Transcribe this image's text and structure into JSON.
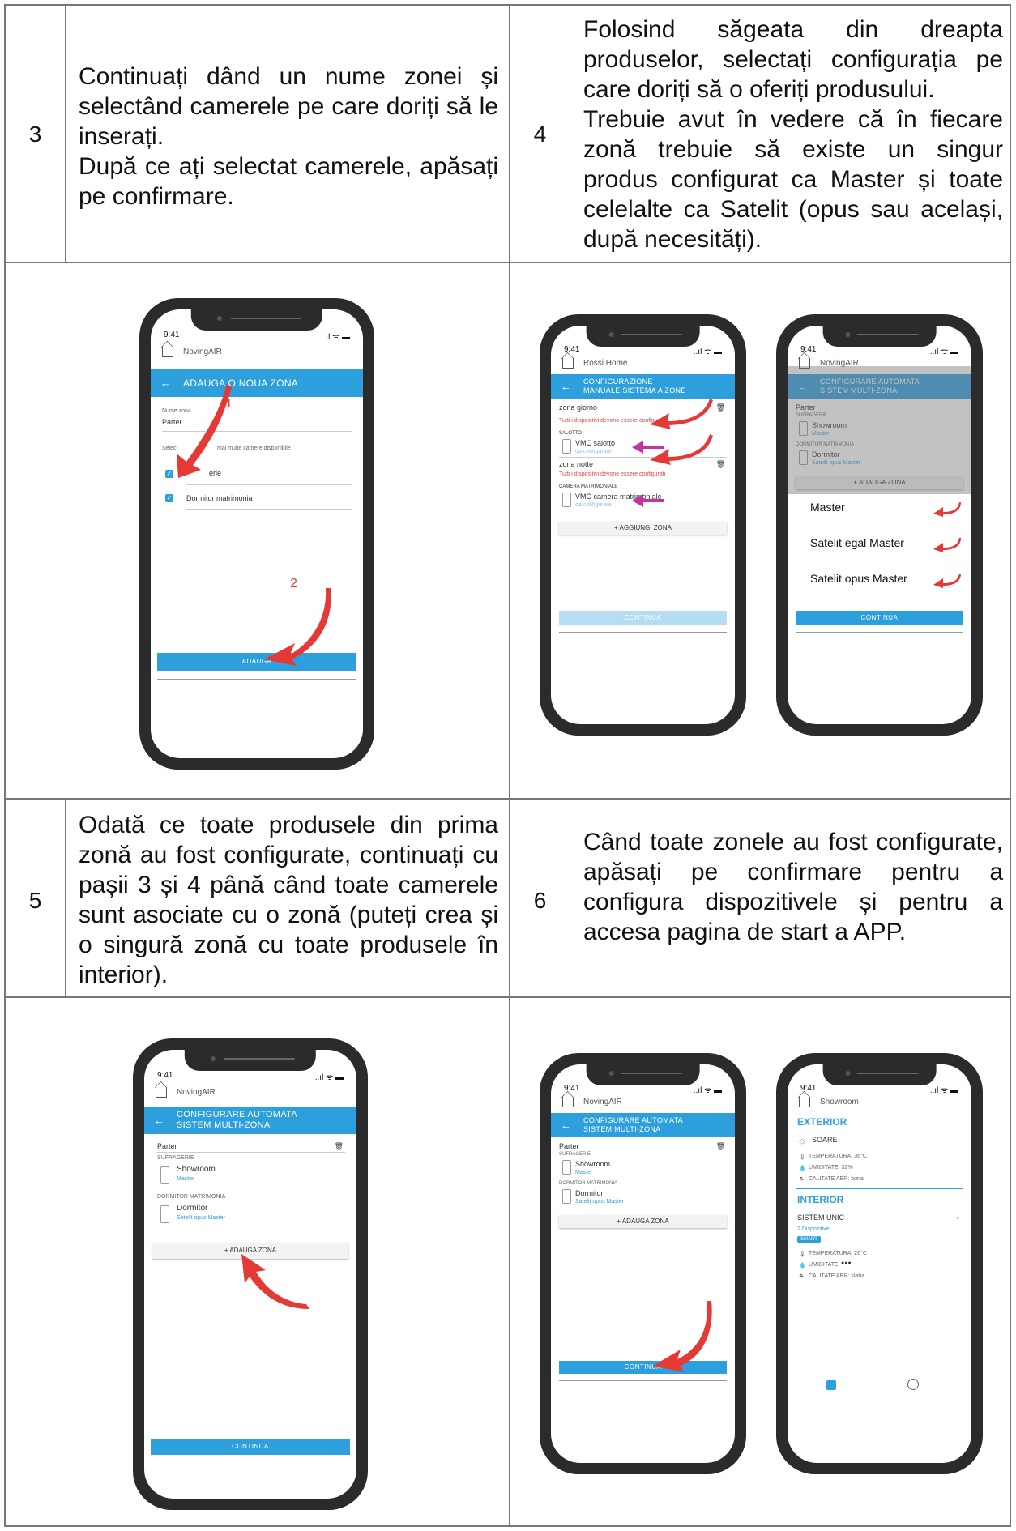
{
  "steps": [
    {
      "number": "3",
      "lines": [
        "Continuați dând un nume zonei și selectând camerele pe care doriți să le inserați.",
        "După ce ați selectat camerele, apăsați pe confirmare."
      ]
    },
    {
      "number": "4",
      "lines": [
        "Folosind săgeata din dreapta produselor, selectați configurația pe care doriți să o oferiți produsului.",
        "Trebuie avut în vedere că în fiecare zonă trebuie să existe un singur produs configurat ca Master și toate celelalte ca Satelit (opus sau același, după necesități)."
      ]
    },
    {
      "number": "5",
      "lines": [
        "Odată ce toate produsele din prima zonă au fost configurate, continuați cu pașii 3 și 4 până când toate camerele sunt asociate cu o zonă (puteți crea și o singură zonă cu toate produsele în interior)."
      ]
    },
    {
      "number": "6",
      "lines": [
        "Când toate zonele au fost configurate, apăsați pe confirmare pentru a configura dispozitivele și pentru a accesa pagina de start a APP."
      ]
    }
  ],
  "status": {
    "time": "9:41",
    "signal": "..ıl ᯤ ▬"
  },
  "phone_a": {
    "home": "NovingAIR",
    "bar": "ADAUGA O NOUA ZONA",
    "name_label": "Nume zona",
    "name_value": "Parter",
    "select_label": "Select",
    "select_rest": "mai multe camere disponibile",
    "room1": "erie",
    "room2": "Dormitor matrimonia",
    "marker1": "1",
    "marker2": "2",
    "button": "ADAUGA"
  },
  "phone_b": {
    "home": "Rossi Home",
    "bar_l1": "CONFIGURAZIONE",
    "bar_l2": "MANUALE SISTEMA A ZONE",
    "zone1": "zona giorno",
    "warn1": "Tutti i dispositivi devono essere configura",
    "room1": "SALOTTO",
    "dev1": "VMC salotto",
    "dev1_sub": "da configurare",
    "zone2": "zona notte",
    "warn2": "Tutti i dispositivi devono essere configurati",
    "room2": "CAMERA MATRIMONIALE",
    "dev2": "VMC camera matrimoniale",
    "dev2_sub": "da configurare",
    "add": "+ AGGIUNGI ZONA",
    "cont": "CONTINUA"
  },
  "phone_c": {
    "home": "NovingAIR",
    "bar_l1": "CONFIGURARE AUTOMATA",
    "bar_l2": "SISTEM MULTI-ZONA",
    "zone": "Parter",
    "room1": "SUFRAGERIE",
    "dev1": "Showroom",
    "dev1_sub": "Master",
    "room2": "DORMITOR MATRIMONIA",
    "dev2": "Dormitor",
    "dev2_sub": "Satelit opus Master",
    "add": "+ ADAUGA ZONA",
    "menu": [
      "Master",
      "Satelit egal Master",
      "Satelit opus Master"
    ],
    "cont": "CONTINUA"
  },
  "phone_d": {
    "home": "NovingAIR",
    "bar_l1": "CONFIGURARE AUTOMATA",
    "bar_l2": "SISTEM MULTI-ZONA",
    "zone": "Parter",
    "room1": "SUFRAGERIE",
    "dev1": "Showroom",
    "dev1_sub": "Master",
    "room2": "DORMITOR MATRIMONIA",
    "dev2": "Dormitor",
    "dev2_sub": "Satelit opus Master",
    "add": "+ ADAUGA ZONA",
    "cont": "CONTINUA"
  },
  "phone_f": {
    "home": "Showroom",
    "ext_title": "EXTERIOR",
    "weather": "SOARE",
    "ext_temp": "TEMPERATURA: 36°C",
    "ext_hum": "UMIDITATE: 32%",
    "ext_air": "CALITATE AER: buna",
    "int_title": "INTERIOR",
    "system": "SISTEM UNIC",
    "devices": "2 Dispozitive",
    "badge": "SMART",
    "int_temp": "TEMPERATURA: 26°C",
    "int_hum": "UMIDITATE:",
    "int_air": "CALITATE AER: slaba"
  },
  "colors": {
    "accent": "#2d9fdc",
    "arrow_red": "#e53935",
    "arrow_pink": "#c2359f",
    "warning": "#e64545"
  }
}
